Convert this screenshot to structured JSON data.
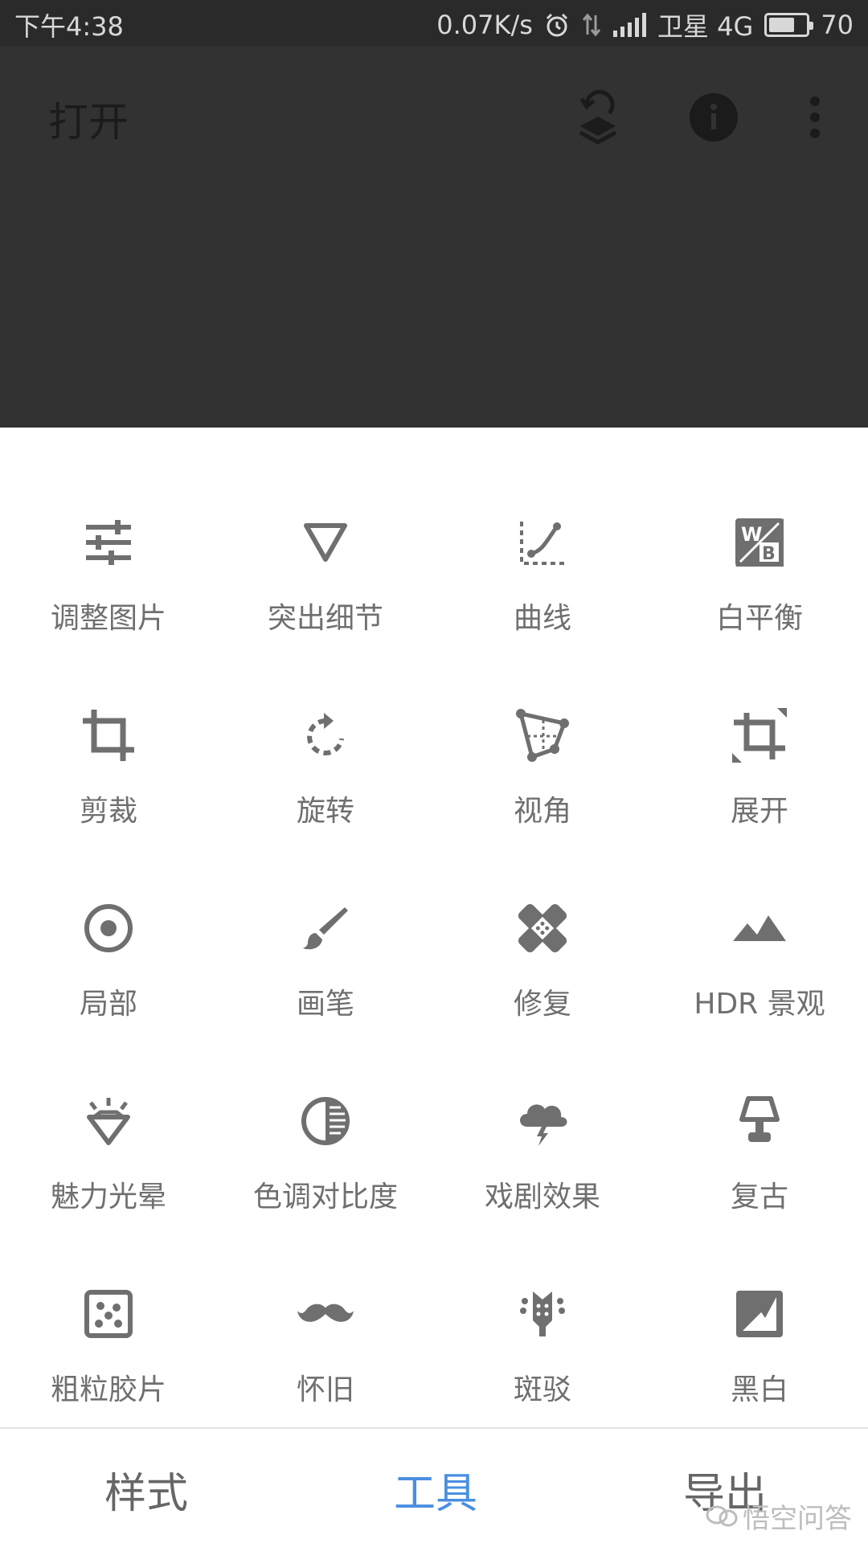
{
  "status_bar": {
    "time": "下午4:38",
    "speed": "0.07K/s",
    "carrier": "卫星 4G",
    "battery": "70",
    "battery_level": 0.7
  },
  "header": {
    "open_label": "打开",
    "icons": [
      "layers-undo-icon",
      "info-icon",
      "more-vert-icon"
    ]
  },
  "tools": [
    [
      {
        "label": "调整图片",
        "icon": "tune-icon"
      },
      {
        "label": "突出细节",
        "icon": "triangle-details-icon"
      },
      {
        "label": "曲线",
        "icon": "curves-icon"
      },
      {
        "label": "白平衡",
        "icon": "white-balance-icon"
      }
    ],
    [
      {
        "label": "剪裁",
        "icon": "crop-icon"
      },
      {
        "label": "旋转",
        "icon": "rotate-icon"
      },
      {
        "label": "视角",
        "icon": "perspective-icon"
      },
      {
        "label": "展开",
        "icon": "expand-icon"
      }
    ],
    [
      {
        "label": "局部",
        "icon": "selective-icon"
      },
      {
        "label": "画笔",
        "icon": "brush-icon"
      },
      {
        "label": "修复",
        "icon": "healing-icon"
      },
      {
        "label": "HDR 景观",
        "icon": "hdr-landscape-icon"
      }
    ],
    [
      {
        "label": "魅力光晕",
        "icon": "glamour-glow-icon"
      },
      {
        "label": "色调对比度",
        "icon": "tonal-contrast-icon"
      },
      {
        "label": "戏剧效果",
        "icon": "drama-icon"
      },
      {
        "label": "复古",
        "icon": "vintage-lamp-icon"
      }
    ],
    [
      {
        "label": "粗粒胶片",
        "icon": "grainy-film-icon"
      },
      {
        "label": "怀旧",
        "icon": "retrolux-mustache-icon"
      },
      {
        "label": "斑驳",
        "icon": "grunge-icon"
      },
      {
        "label": "黑白",
        "icon": "black-white-icon"
      }
    ]
  ],
  "bottom_tabs": {
    "styles": "样式",
    "tools": "工具",
    "export": "导出",
    "active": "tools"
  },
  "watermark": "悟空问答",
  "colors": {
    "accent": "#4a8fe0",
    "icon": "#6f6f6f",
    "dark_bg": "#323232",
    "status_bg": "#2a2a2a"
  }
}
